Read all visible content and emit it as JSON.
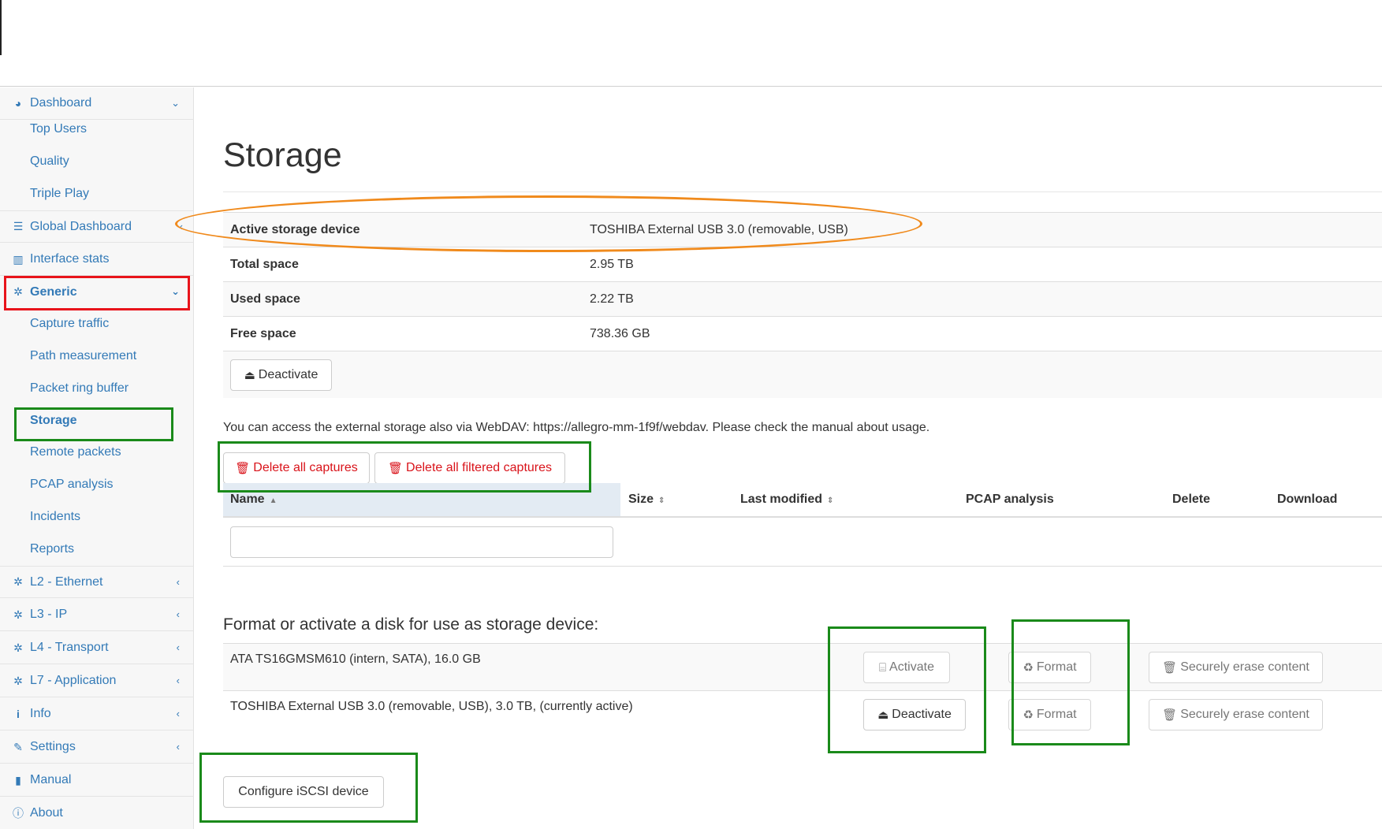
{
  "sidebar": {
    "items": [
      {
        "label": "Dashboard",
        "icon": "dashboard-icon",
        "chevron": "down"
      },
      {
        "label": "Top Users"
      },
      {
        "label": "Quality"
      },
      {
        "label": "Triple Play"
      },
      {
        "label": "Global Dashboard",
        "icon": "server-icon",
        "chevron": "left"
      },
      {
        "label": "Interface stats",
        "icon": "bar-chart-icon"
      },
      {
        "label": "Generic",
        "icon": "gear-icon",
        "chevron": "down"
      },
      {
        "label": "Capture traffic"
      },
      {
        "label": "Path measurement"
      },
      {
        "label": "Packet ring buffer"
      },
      {
        "label": "Storage"
      },
      {
        "label": "Remote packets"
      },
      {
        "label": "PCAP analysis"
      },
      {
        "label": "Incidents"
      },
      {
        "label": "Reports"
      },
      {
        "label": "L2 - Ethernet",
        "icon": "gear-icon",
        "chevron": "left"
      },
      {
        "label": "L3 - IP",
        "icon": "gear-icon",
        "chevron": "left"
      },
      {
        "label": "L4 - Transport",
        "icon": "gear-icon",
        "chevron": "left"
      },
      {
        "label": "L7 - Application",
        "icon": "gear-icon",
        "chevron": "left"
      },
      {
        "label": "Info",
        "icon": "info-icon",
        "chevron": "left"
      },
      {
        "label": "Settings",
        "icon": "wrench-icon",
        "chevron": "left"
      },
      {
        "label": "Manual",
        "icon": "book-icon"
      },
      {
        "label": "About",
        "icon": "info-circle-icon"
      }
    ]
  },
  "page": {
    "title": "Storage"
  },
  "storage_info": {
    "rows": [
      {
        "key": "Active storage device",
        "value": "TOSHIBA External USB 3.0 (removable, USB)"
      },
      {
        "key": "Total space",
        "value": "2.95 TB"
      },
      {
        "key": "Used space",
        "value": "2.22 TB"
      },
      {
        "key": "Free space",
        "value": "738.36 GB"
      }
    ],
    "deactivate_label": "Deactivate"
  },
  "webdav_text": "You can access the external storage also via WebDAV: https://allegro-mm-1f9f/webdav. Please check the manual about usage.",
  "captures": {
    "delete_all_label": "Delete all captures",
    "delete_filtered_label": "Delete all filtered captures",
    "columns": [
      "Name",
      "Size",
      "Last modified",
      "PCAP analysis",
      "Delete",
      "Download"
    ],
    "filter_value": ""
  },
  "disks": {
    "title": "Format or activate a disk for use as storage device:",
    "rows": [
      {
        "name": "ATA TS16GMSM610 (intern, SATA), 16.0 GB",
        "action_label": "Activate",
        "format_label": "Format",
        "erase_label": "Securely erase content"
      },
      {
        "name": "TOSHIBA External USB 3.0 (removable, USB), 3.0 TB, (currently active)",
        "action_label": "Deactivate",
        "format_label": "Format",
        "erase_label": "Securely erase content"
      }
    ],
    "iscsi_label": "Configure iSCSI device"
  },
  "colors": {
    "link": "#337ab7",
    "danger": "#d9131a",
    "annotation_red": "#e8141b",
    "annotation_green": "#1a8a1a",
    "annotation_orange": "#f08a1c"
  }
}
